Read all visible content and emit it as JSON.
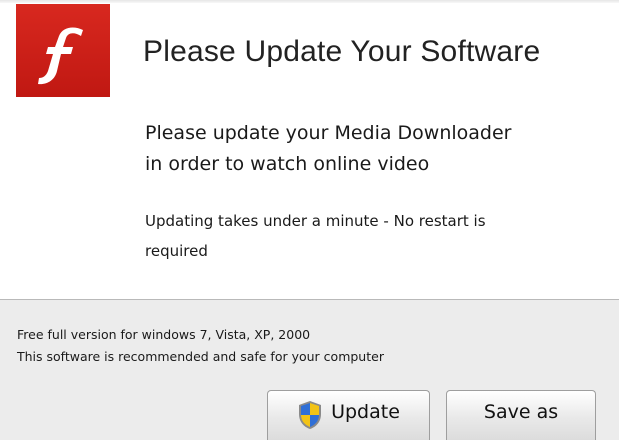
{
  "dialog": {
    "title": "Please Update Your Software",
    "message_line1": "Please update your Media Downloader",
    "message_line2": "in order to watch online video",
    "note_line1": "Updating takes under a minute - No restart is",
    "note_line2": "required"
  },
  "logo": {
    "icon": "flash-player-icon",
    "bg_color": "#cc1f17"
  },
  "footer": {
    "line1": "Free full version for windows 7, Vista, XP, 2000",
    "line2": "This software is recommended and safe for your computer"
  },
  "buttons": {
    "update_label": "Update",
    "update_icon": "uac-shield-icon",
    "save_label": "Save as"
  }
}
